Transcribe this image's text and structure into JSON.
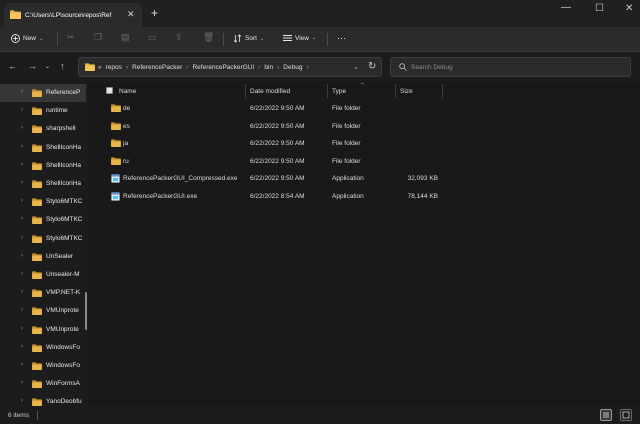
{
  "window": {
    "tab_title": "C:\\Users\\LP\\source\\repos\\Ref",
    "tab_close": "✕",
    "new_tab": "+",
    "minimize": "—",
    "maximize": "☐",
    "close": "✕"
  },
  "toolbar": {
    "new_label": "New",
    "sort_label": "Sort",
    "view_label": "View",
    "more_label": "···",
    "icons": [
      "cut-icon",
      "copy-icon",
      "paste-icon",
      "rename-icon",
      "share-icon",
      "delete-icon"
    ]
  },
  "address": {
    "crumbs": [
      "«",
      "repos",
      "ReferencePacker",
      "ReferencePackerGUI",
      "bin",
      "Debug"
    ],
    "search_placeholder": "Search Debug"
  },
  "sidebar": {
    "items": [
      {
        "label": "ReferenceP",
        "selected": true
      },
      {
        "label": "runtime"
      },
      {
        "label": "sharpshell"
      },
      {
        "label": "ShellIconHa"
      },
      {
        "label": "ShellIconHa"
      },
      {
        "label": "ShellIconHa"
      },
      {
        "label": "Stylo6MTKC"
      },
      {
        "label": "Stylo6MTKC"
      },
      {
        "label": "Stylo6MTKC"
      },
      {
        "label": "UnSealer"
      },
      {
        "label": "Unsealer-M"
      },
      {
        "label": "VMP.NET-K"
      },
      {
        "label": "VMUnprote"
      },
      {
        "label": "VMUnprote"
      },
      {
        "label": "WindowsFo"
      },
      {
        "label": "WindowsFo"
      },
      {
        "label": "WinFormsA"
      },
      {
        "label": "YanoDeobfu"
      }
    ]
  },
  "columns": {
    "name": "Name",
    "date": "Date modified",
    "type": "Type",
    "size": "Size"
  },
  "files": [
    {
      "name": "de",
      "date": "6/22/2022 9:50 AM",
      "type": "File folder",
      "size": "",
      "kind": "folder"
    },
    {
      "name": "es",
      "date": "6/22/2022 9:50 AM",
      "type": "File folder",
      "size": "",
      "kind": "folder"
    },
    {
      "name": "ja",
      "date": "6/22/2022 9:50 AM",
      "type": "File folder",
      "size": "",
      "kind": "folder"
    },
    {
      "name": "ru",
      "date": "6/22/2022 9:50 AM",
      "type": "File folder",
      "size": "",
      "kind": "folder"
    },
    {
      "name": "ReferencePackerGUI_Compressed.exe",
      "date": "6/22/2022 9:50 AM",
      "type": "Application",
      "size": "32,093 KB",
      "kind": "exe"
    },
    {
      "name": "ReferencePackerGUI.exe",
      "date": "6/22/2022 8:54 AM",
      "type": "Application",
      "size": "78,144 KB",
      "kind": "exe"
    }
  ],
  "status": {
    "item_count": "6 items"
  },
  "colors": {
    "folder": "#e8b54a",
    "folder_dark": "#c9922a",
    "accent": "#4cc2ff"
  }
}
